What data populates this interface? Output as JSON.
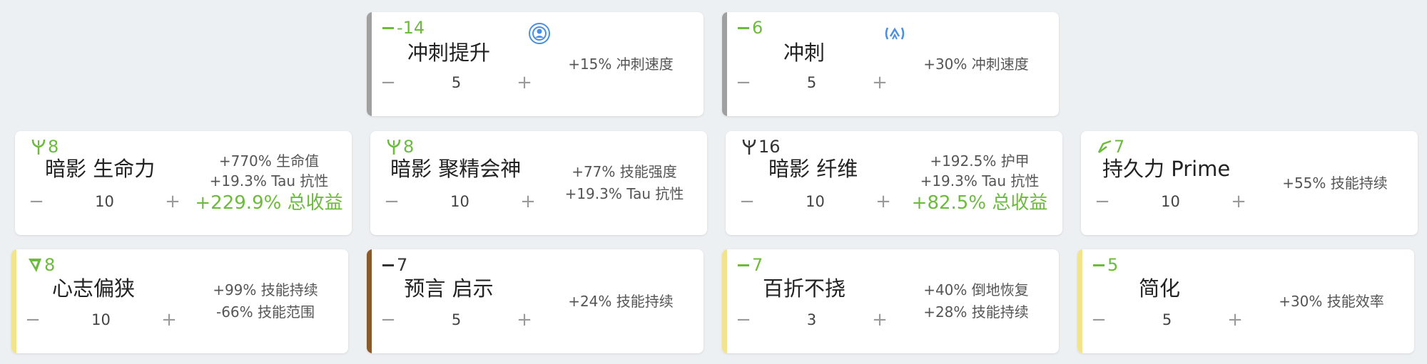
{
  "colors": {
    "green": "#6cbb3c",
    "dark": "#333333",
    "blue": "#4a90e2",
    "gray_bar": "#a0a0a0",
    "brown_bar": "#8a5a2b",
    "yellow_bar": "#f2e38e"
  },
  "cards": [
    {
      "drain": "-14",
      "drain_color": "green",
      "drain_icon": "dash-icon",
      "name": "冲刺提升",
      "rank": "5",
      "stats": [
        "+15% 冲刺速度"
      ],
      "highlight": "",
      "polarity_icon": "umbra-icon"
    },
    {
      "drain": "6",
      "drain_color": "green",
      "drain_icon": "dash-icon",
      "name": "冲刺",
      "rank": "5",
      "stats": [
        "+30% 冲刺速度"
      ],
      "highlight": "",
      "polarity_icon": "aura-icon"
    },
    {
      "drain": "8",
      "drain_color": "green",
      "drain_icon": "umbra-polarity-icon",
      "name": "暗影 生命力",
      "rank": "10",
      "stats": [
        "+770% 生命值",
        "+19.3% Tau 抗性"
      ],
      "highlight": "+229.9% 总收益"
    },
    {
      "drain": "8",
      "drain_color": "green",
      "drain_icon": "umbra-polarity-icon",
      "name": "暗影 聚精会神",
      "rank": "10",
      "stats": [
        "+77% 技能强度",
        "+19.3% Tau 抗性"
      ],
      "highlight": ""
    },
    {
      "drain": "16",
      "drain_color": "dark",
      "drain_icon": "umbra-polarity-icon",
      "name": "暗影 纤维",
      "rank": "10",
      "stats": [
        "+192.5% 护甲",
        "+19.3% Tau 抗性"
      ],
      "highlight": "+82.5% 总收益"
    },
    {
      "drain": "7",
      "drain_color": "green",
      "drain_icon": "madurai-polarity-icon",
      "name": "持久力 Prime",
      "rank": "10",
      "stats": [
        "+55% 技能持续"
      ],
      "highlight": ""
    },
    {
      "drain": "8",
      "drain_color": "green",
      "drain_icon": "naramon-polarity-icon",
      "name": "心志偏狭",
      "rank": "10",
      "stats": [
        "+99% 技能持续",
        "-66% 技能范围"
      ],
      "highlight": ""
    },
    {
      "drain": "7",
      "drain_color": "dark",
      "drain_icon": "dash-icon",
      "name": "预言 启示",
      "rank": "5",
      "stats": [
        "+24% 技能持续"
      ],
      "highlight": ""
    },
    {
      "drain": "7",
      "drain_color": "green",
      "drain_icon": "dash-icon",
      "name": "百折不挠",
      "rank": "3",
      "stats": [
        "+40% 倒地恢复",
        "+28% 技能持续"
      ],
      "highlight": ""
    },
    {
      "drain": "5",
      "drain_color": "green",
      "drain_icon": "dash-icon",
      "name": "简化",
      "rank": "5",
      "stats": [
        "+30% 技能效率"
      ],
      "highlight": ""
    }
  ],
  "controls": {
    "minus": "−",
    "plus": "+"
  }
}
